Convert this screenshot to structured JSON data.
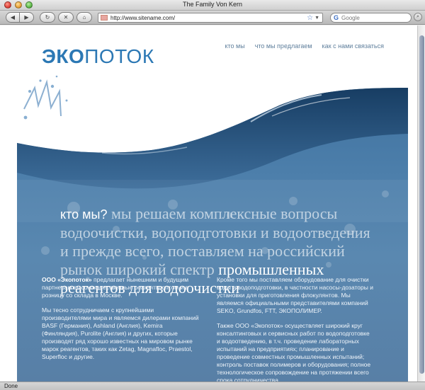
{
  "window": {
    "title": "The Family Von Kern"
  },
  "toolbar": {
    "url": "http://www.sitename.com/",
    "search_placeholder": "Google",
    "search_engine": "G"
  },
  "site": {
    "logo_bold": "ЭКО",
    "logo_rest": "ПОТОК",
    "nav": [
      "кто мы",
      "что мы предлагаем",
      "как с нами связаться"
    ]
  },
  "hero": {
    "lead": "кто мы?",
    "headline_dim": " мы решаем комплексные вопросы водоочистки, водоподготовки и водоотведения и прежде всего, поставляем на российский рынок широкий спектр ",
    "headline_bright": "промышленных реагентов для водоочистки"
  },
  "content": {
    "left": {
      "p1_bold": "ООО «Экопоток»",
      "p1_rest": " предлагает нынешним и будущим партнерам высококачественные реагенты оптом и в розницу со склада в Москве.",
      "p2": "Мы тесно сотрудничаем с крупнейшими производителями мира и являемся дилерами компаний BASF (Германия), Ashland (Англия), Kemira (Финляндия), Purolite (Англия) и других, которые производят ряд хорошо известных на мировом рынке марок реагентов, таких как Zetag, Magnafloc, Praestol, Superfloc и другие."
    },
    "right": {
      "p1": "Кроме того мы поставляем оборудование для очистки воды и водоподготовки, в частности насосы-дозаторы и установки для приготовления флокулянтов. Мы являемся официальными представителями компаний SEKO, Grundfos, FTT, ЭКОПОЛИМЕР.",
      "p2": "Также ООО «Экопоток» осуществляет широкий круг консалтинговых и сервисных работ по водоподготовке и водоотведению, в т.ч. проведение лабораторных испытаний на предприятиях; планирование и проведение совместных промышленных испытаний; контроль поставок полимеров и оборудования; полное технологическое сопровождение на протяжении всего срока сотрудничества."
    }
  },
  "status": {
    "text": "Done"
  },
  "colors": {
    "accent": "#2c78b4",
    "hero": "#4d7fab",
    "nav": "#5f7f9c"
  }
}
